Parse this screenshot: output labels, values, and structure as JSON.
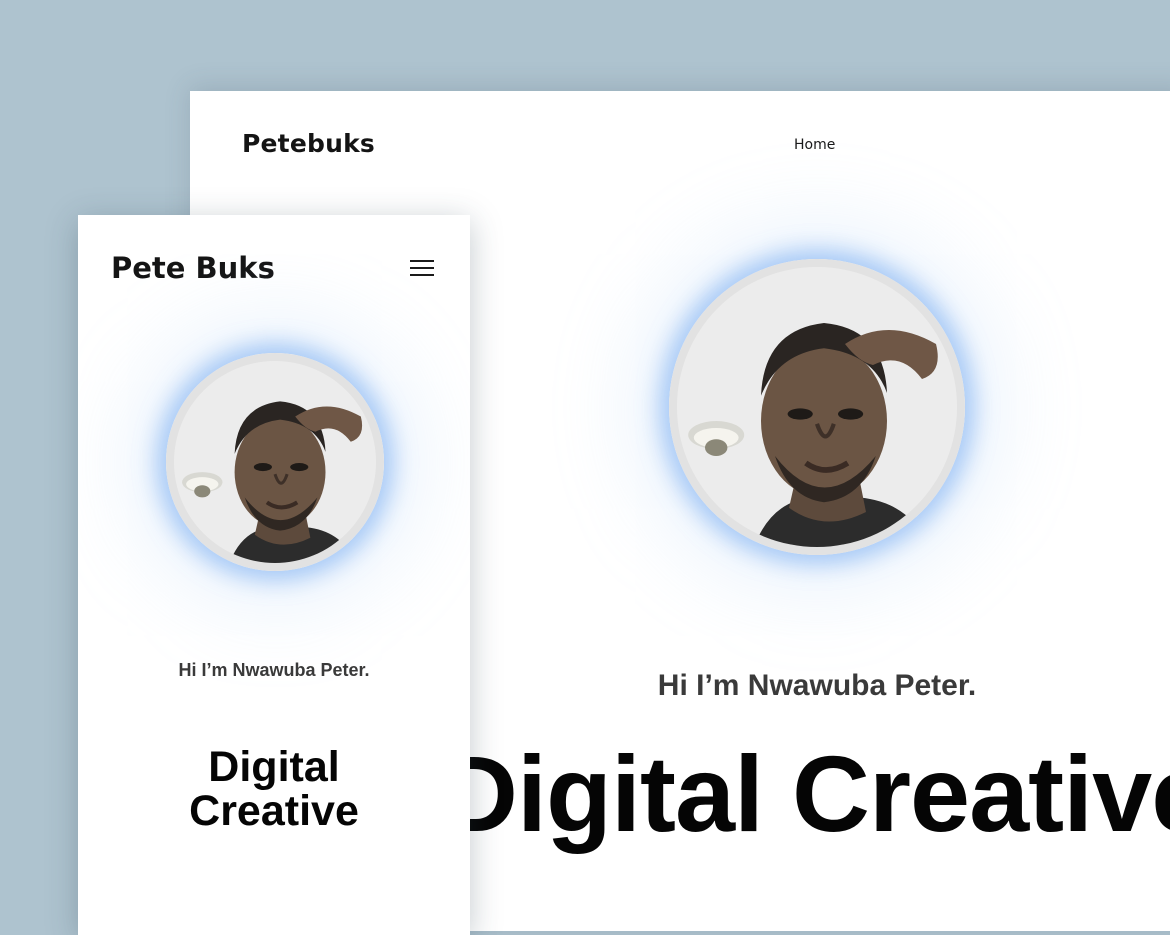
{
  "desktop": {
    "brand": "Petebuks",
    "nav": {
      "home_label": "Home"
    },
    "greeting": "Hi I’m Nwawuba Peter.",
    "headline": "Digital Creative"
  },
  "mobile": {
    "brand": "Pete Buks",
    "menu_icon": "hamburger-menu-icon",
    "greeting": "Hi I’m Nwawuba Peter.",
    "headline": "Digital Creative"
  },
  "colors": {
    "background": "#aec3cf",
    "card": "#ffffff",
    "text": "#141414",
    "glow": "#6ea5f0"
  }
}
